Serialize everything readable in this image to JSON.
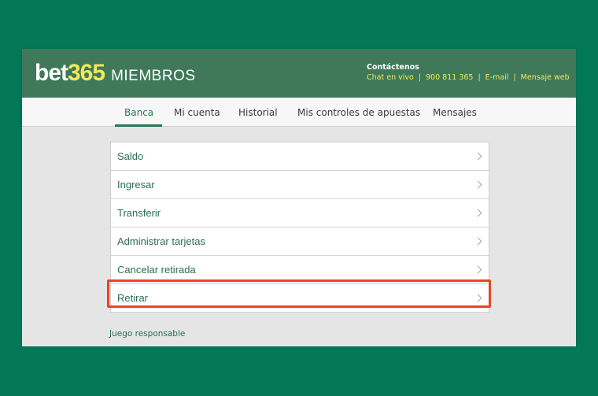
{
  "header": {
    "logo_bet": "bet",
    "logo_365": "365",
    "logo_members": "MIEMBROS",
    "contact_title": "Contáctenos",
    "contact_links": [
      "Chat en vivo",
      "900 811 365",
      "E-mail",
      "Mensaje web"
    ],
    "separator": "|"
  },
  "nav": {
    "tabs": [
      "Banca",
      "Mi cuenta",
      "Historial",
      "Mis controles de apuestas",
      "Mensajes"
    ],
    "active": "Banca"
  },
  "menu": {
    "items": [
      "Saldo",
      "Ingresar",
      "Transferir",
      "Administrar tarjetas",
      "Cancelar retirada",
      "Retirar"
    ],
    "highlighted": "Retirar"
  },
  "footer": {
    "link": "Juego responsable"
  },
  "colors": {
    "background": "#027858",
    "header": "#3f795a",
    "accent_yellow": "#f3e75b",
    "link_green": "#2a6f4e",
    "highlight_red": "#e84427"
  }
}
